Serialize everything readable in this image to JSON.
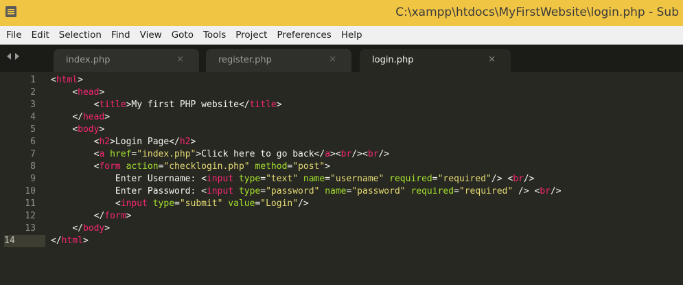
{
  "window": {
    "title": "C:\\xampp\\htdocs\\MyFirstWebsite\\login.php - Sub"
  },
  "menu": [
    "File",
    "Edit",
    "Selection",
    "Find",
    "View",
    "Goto",
    "Tools",
    "Project",
    "Preferences",
    "Help"
  ],
  "tabs": [
    {
      "label": "index.php",
      "close": "×",
      "active": false
    },
    {
      "label": "register.php",
      "close": "×",
      "active": false
    },
    {
      "label": "login.php",
      "close": "×",
      "active": true
    }
  ],
  "editor": {
    "current_line": 14,
    "lines": [
      {
        "number": "1",
        "tokens": [
          {
            "t": "<",
            "k": "punct"
          },
          {
            "t": "html",
            "k": "tag"
          },
          {
            "t": ">",
            "k": "punct"
          }
        ]
      },
      {
        "number": "2",
        "tokens": [
          {
            "t": "    ",
            "k": "text"
          },
          {
            "t": "<",
            "k": "punct"
          },
          {
            "t": "head",
            "k": "tag"
          },
          {
            "t": ">",
            "k": "punct"
          }
        ]
      },
      {
        "number": "3",
        "tokens": [
          {
            "t": "        ",
            "k": "text"
          },
          {
            "t": "<",
            "k": "punct"
          },
          {
            "t": "title",
            "k": "tag"
          },
          {
            "t": ">My first PHP website</",
            "k": "punct"
          },
          {
            "t": "title",
            "k": "tag"
          },
          {
            "t": ">",
            "k": "punct"
          }
        ]
      },
      {
        "number": "4",
        "tokens": [
          {
            "t": "    ",
            "k": "text"
          },
          {
            "t": "</",
            "k": "punct"
          },
          {
            "t": "head",
            "k": "tag"
          },
          {
            "t": ">",
            "k": "punct"
          }
        ]
      },
      {
        "number": "5",
        "tokens": [
          {
            "t": "    ",
            "k": "text"
          },
          {
            "t": "<",
            "k": "punct"
          },
          {
            "t": "body",
            "k": "tag"
          },
          {
            "t": ">",
            "k": "punct"
          }
        ]
      },
      {
        "number": "6",
        "tokens": [
          {
            "t": "        ",
            "k": "text"
          },
          {
            "t": "<",
            "k": "punct"
          },
          {
            "t": "h2",
            "k": "tag"
          },
          {
            "t": ">Login Page</",
            "k": "punct"
          },
          {
            "t": "h2",
            "k": "tag"
          },
          {
            "t": ">",
            "k": "punct"
          }
        ]
      },
      {
        "number": "7",
        "tokens": [
          {
            "t": "        ",
            "k": "text"
          },
          {
            "t": "<",
            "k": "punct"
          },
          {
            "t": "a",
            "k": "tag"
          },
          {
            "t": " href",
            "k": "attr"
          },
          {
            "t": "=",
            "k": "punct"
          },
          {
            "t": "\"index.php\"",
            "k": "string"
          },
          {
            "t": ">Click here to go back</",
            "k": "punct"
          },
          {
            "t": "a",
            "k": "tag"
          },
          {
            "t": "><",
            "k": "punct"
          },
          {
            "t": "br",
            "k": "tag"
          },
          {
            "t": "/><",
            "k": "punct"
          },
          {
            "t": "br",
            "k": "tag"
          },
          {
            "t": "/>",
            "k": "punct"
          }
        ]
      },
      {
        "number": "8",
        "tokens": [
          {
            "t": "        ",
            "k": "text"
          },
          {
            "t": "<",
            "k": "punct"
          },
          {
            "t": "form",
            "k": "tag"
          },
          {
            "t": " action",
            "k": "attr"
          },
          {
            "t": "=",
            "k": "punct"
          },
          {
            "t": "\"checklogin.php\"",
            "k": "string"
          },
          {
            "t": " method",
            "k": "attr"
          },
          {
            "t": "=",
            "k": "punct"
          },
          {
            "t": "\"post\"",
            "k": "string"
          },
          {
            "t": ">",
            "k": "punct"
          }
        ]
      },
      {
        "number": "9",
        "tokens": [
          {
            "t": "            Enter Username: ",
            "k": "text"
          },
          {
            "t": "<",
            "k": "punct"
          },
          {
            "t": "input",
            "k": "tag"
          },
          {
            "t": " type",
            "k": "attr"
          },
          {
            "t": "=",
            "k": "punct"
          },
          {
            "t": "\"text\"",
            "k": "string"
          },
          {
            "t": " name",
            "k": "attr"
          },
          {
            "t": "=",
            "k": "punct"
          },
          {
            "t": "\"username\"",
            "k": "string"
          },
          {
            "t": " required",
            "k": "attr"
          },
          {
            "t": "=",
            "k": "punct"
          },
          {
            "t": "\"required\"",
            "k": "string"
          },
          {
            "t": "/> <",
            "k": "punct"
          },
          {
            "t": "br",
            "k": "tag"
          },
          {
            "t": "/>",
            "k": "punct"
          }
        ]
      },
      {
        "number": "10",
        "tokens": [
          {
            "t": "            Enter Password: ",
            "k": "text"
          },
          {
            "t": "<",
            "k": "punct"
          },
          {
            "t": "input",
            "k": "tag"
          },
          {
            "t": " type",
            "k": "attr"
          },
          {
            "t": "=",
            "k": "punct"
          },
          {
            "t": "\"password\"",
            "k": "string"
          },
          {
            "t": " name",
            "k": "attr"
          },
          {
            "t": "=",
            "k": "punct"
          },
          {
            "t": "\"password\"",
            "k": "string"
          },
          {
            "t": " required",
            "k": "attr"
          },
          {
            "t": "=",
            "k": "punct"
          },
          {
            "t": "\"required\"",
            "k": "string"
          },
          {
            "t": " /> <",
            "k": "punct"
          },
          {
            "t": "br",
            "k": "tag"
          },
          {
            "t": "/>",
            "k": "punct"
          }
        ]
      },
      {
        "number": "11",
        "tokens": [
          {
            "t": "            ",
            "k": "text"
          },
          {
            "t": "<",
            "k": "punct"
          },
          {
            "t": "input",
            "k": "tag"
          },
          {
            "t": " type",
            "k": "attr"
          },
          {
            "t": "=",
            "k": "punct"
          },
          {
            "t": "\"submit\"",
            "k": "string"
          },
          {
            "t": " value",
            "k": "attr"
          },
          {
            "t": "=",
            "k": "punct"
          },
          {
            "t": "\"Login\"",
            "k": "string"
          },
          {
            "t": "/>",
            "k": "punct"
          }
        ]
      },
      {
        "number": "12",
        "tokens": [
          {
            "t": "        ",
            "k": "text"
          },
          {
            "t": "</",
            "k": "punct"
          },
          {
            "t": "form",
            "k": "tag"
          },
          {
            "t": ">",
            "k": "punct"
          }
        ]
      },
      {
        "number": "13",
        "tokens": [
          {
            "t": "    ",
            "k": "text"
          },
          {
            "t": "</",
            "k": "punct"
          },
          {
            "t": "body",
            "k": "tag"
          },
          {
            "t": ">",
            "k": "punct"
          }
        ]
      },
      {
        "number": "14",
        "tokens": [
          {
            "t": "</",
            "k": "punct"
          },
          {
            "t": "html",
            "k": "tag"
          },
          {
            "t": ">",
            "k": "punct"
          }
        ]
      }
    ]
  }
}
